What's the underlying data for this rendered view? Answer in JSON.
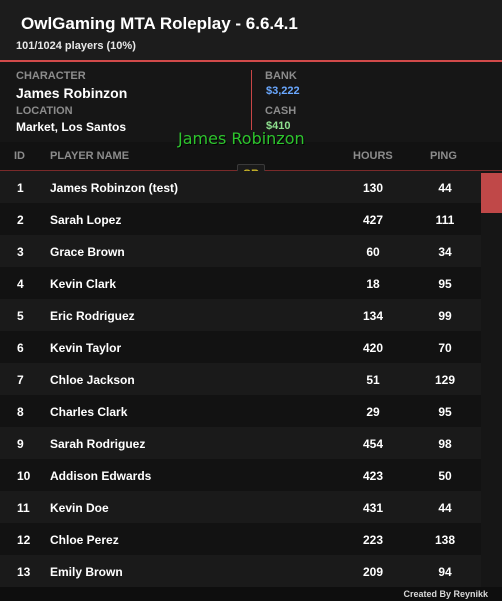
{
  "header": {
    "title": "OwlGaming MTA Roleplay - 6.6.4.1",
    "players": "101/1024 players (10%)"
  },
  "info": {
    "character_label": "CHARACTER",
    "character_name": "James Robinzon",
    "location_label": "LOCATION",
    "location_value": "Market, Los Santos",
    "bank_label": "BANK",
    "bank_value": "$3,222",
    "cash_label": "CASH",
    "cash_value": "$410"
  },
  "overlay": {
    "nametag": "James Robinzon",
    "badge": "SP"
  },
  "columns": {
    "id": "ID",
    "name": "PLAYER NAME",
    "hours": "HOURS",
    "ping": "PING"
  },
  "players": [
    {
      "id": "1",
      "name": "James Robinzon (test)",
      "hours": "130",
      "ping": "44"
    },
    {
      "id": "2",
      "name": "Sarah Lopez",
      "hours": "427",
      "ping": "111"
    },
    {
      "id": "3",
      "name": "Grace Brown",
      "hours": "60",
      "ping": "34"
    },
    {
      "id": "4",
      "name": "Kevin Clark",
      "hours": "18",
      "ping": "95"
    },
    {
      "id": "5",
      "name": "Eric Rodriguez",
      "hours": "134",
      "ping": "99"
    },
    {
      "id": "6",
      "name": "Kevin Taylor",
      "hours": "420",
      "ping": "70"
    },
    {
      "id": "7",
      "name": "Chloe Jackson",
      "hours": "51",
      "ping": "129"
    },
    {
      "id": "8",
      "name": "Charles Clark",
      "hours": "29",
      "ping": "95"
    },
    {
      "id": "9",
      "name": "Sarah Rodriguez",
      "hours": "454",
      "ping": "98"
    },
    {
      "id": "10",
      "name": "Addison Edwards",
      "hours": "423",
      "ping": "50"
    },
    {
      "id": "11",
      "name": "Kevin Doe",
      "hours": "431",
      "ping": "44"
    },
    {
      "id": "12",
      "name": "Chloe Perez",
      "hours": "223",
      "ping": "138"
    },
    {
      "id": "13",
      "name": "Emily Brown",
      "hours": "209",
      "ping": "94"
    }
  ],
  "footer": {
    "credit": "Created By Reynikk"
  },
  "colors": {
    "accent": "#d24a4a",
    "bank": "#6aa8ff",
    "cash": "#8fe08f",
    "nametag": "#2ec42e",
    "badge": "#c8b428"
  }
}
